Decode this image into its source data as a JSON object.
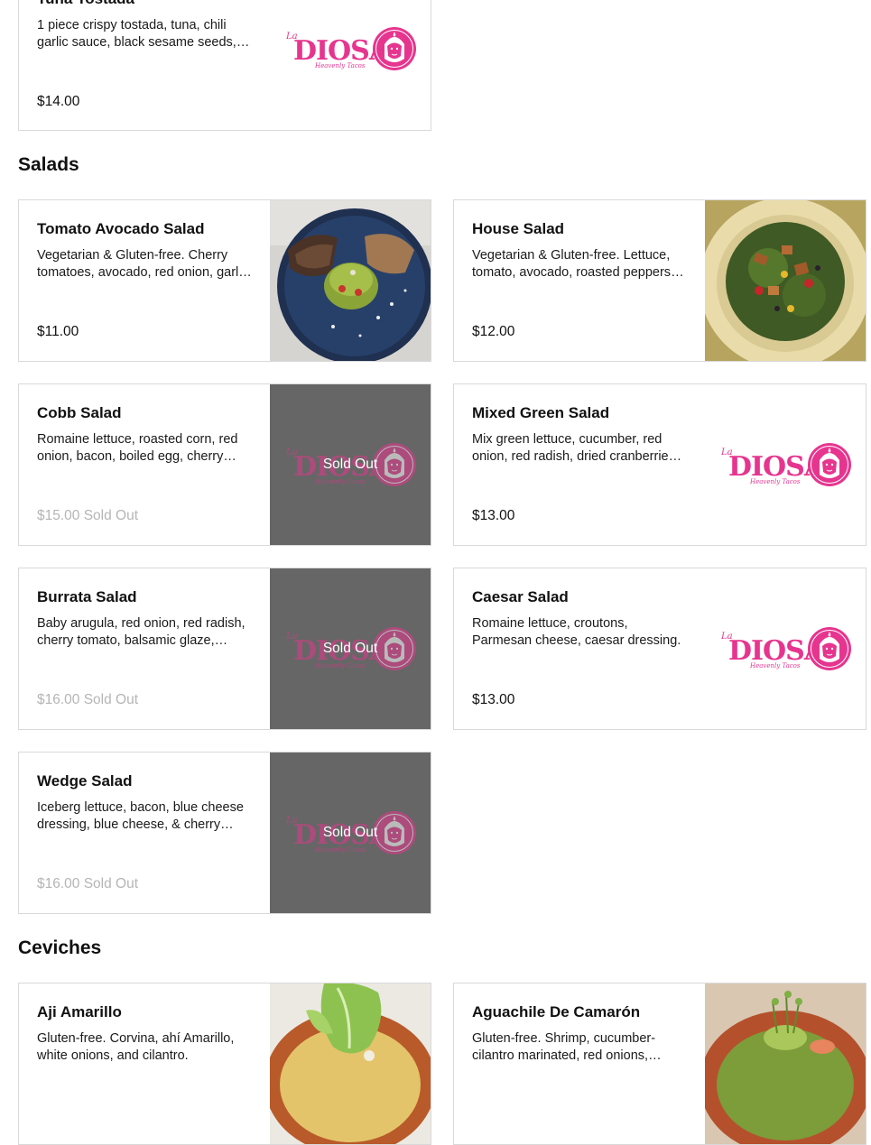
{
  "colors": {
    "brand": "#e6358f",
    "sold_overlay": "#666666",
    "card_border": "#d9d9d9",
    "muted_price": "#b5b5b5"
  },
  "brand_logo": {
    "icon": "la-diosa-logo",
    "text_main": "DIOSA",
    "text_small": "La",
    "tagline": "Heavenly Tacos"
  },
  "items": {
    "tuna_tostada": {
      "title": "Tuna Tostada",
      "desc": "1 piece crispy tostada, tuna, chili garlic sauce, black sesame seeds, avocado",
      "price": "$14.00"
    },
    "tomato_avocado_salad": {
      "title": "Tomato Avocado Salad",
      "desc": "Vegetarian & Gluten-free. Cherry tomatoes, avocado, red onion, garlic, lime",
      "price": "$11.00"
    },
    "house_salad": {
      "title": "House Salad",
      "desc": "Vegetarian & Gluten-free. Lettuce, tomato, avocado, roasted peppers, corn",
      "price": "$12.00"
    },
    "cobb_salad": {
      "title": "Cobb Salad",
      "desc": "Romaine lettuce, roasted corn, red onion, bacon, boiled egg, cherry tomato",
      "price": "$15.00 Sold Out",
      "sold_label": "Sold Out"
    },
    "mixed_green_salad": {
      "title": "Mixed Green Salad",
      "desc": "Mix green lettuce, cucumber, red onion, red radish, dried cranberries, walnuts",
      "price": "$13.00"
    },
    "burrata_salad": {
      "title": "Burrata Salad",
      "desc": "Baby arugula, red onion, red radish, cherry tomato, balsamic glaze, burrata",
      "price": "$16.00 Sold Out",
      "sold_label": "Sold Out"
    },
    "caesar_salad": {
      "title": "Caesar Salad",
      "desc": "Romaine lettuce, croutons, Parmesan cheese, caesar dressing.",
      "price": "$13.00"
    },
    "wedge_salad": {
      "title": "Wedge Salad",
      "desc": "Iceberg lettuce, bacon, blue cheese dressing, blue cheese, & cherry tomato",
      "price": "$16.00 Sold Out",
      "sold_label": "Sold Out"
    },
    "aji_amarillo": {
      "title": "Aji Amarillo",
      "desc": "Gluten-free. Corvina, ahí Amarillo, white onions, and cilantro.",
      "price": ""
    },
    "aguachile_de_camaron": {
      "title": "Aguachile De Camarón",
      "desc": "Gluten-free. Shrimp, cucumber-cilantro marinated, red onions, avocado",
      "price": ""
    }
  },
  "sections": {
    "salads": "Salads",
    "ceviches": "Ceviches"
  }
}
